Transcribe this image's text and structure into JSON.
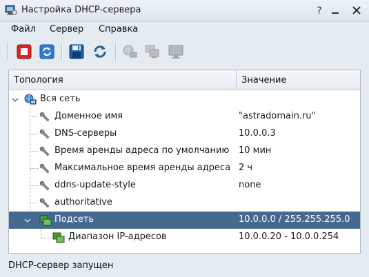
{
  "window": {
    "title": "Настройка DHCP-сервера"
  },
  "menu": [
    {
      "label": "Файл"
    },
    {
      "label": "Сервер"
    },
    {
      "label": "Справка"
    }
  ],
  "toolbar": {
    "icons": [
      "stop-icon",
      "refresh-icon",
      "save-icon",
      "reload-icon",
      "network-icon",
      "copy-computer-icon",
      "monitor-icon"
    ]
  },
  "table": {
    "columns": [
      "Топология",
      "Значение"
    ],
    "rows": [
      {
        "name": "Вся сеть",
        "value": ""
      },
      {
        "name": "Доменное имя",
        "value": "\"astradomain.ru\""
      },
      {
        "name": "DNS-серверы",
        "value": "10.0.0.3"
      },
      {
        "name": "Время аренды адреса по умолчанию",
        "value": "10 мин"
      },
      {
        "name": "Максимальное время аренды адреса",
        "value": "2 ч"
      },
      {
        "name": "ddns-update-style",
        "value": "none"
      },
      {
        "name": "authoritative",
        "value": ""
      },
      {
        "name": "Подсеть",
        "value": "10.0.0.0 / 255.255.255.0"
      },
      {
        "name": "Диапазон IP-адресов",
        "value": "10.0.0.20 - 10.0.0.254"
      }
    ]
  },
  "status": "DHCP-сервер запущен",
  "colors": {
    "selection": "#466a8f",
    "stop": "#d9262b",
    "accent": "#2f7fd1"
  }
}
